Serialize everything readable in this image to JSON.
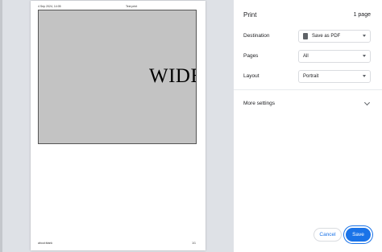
{
  "preview": {
    "header_left": "4 Sep 2024, 14:05",
    "header_center": "Test print",
    "footer_left": "about:blank",
    "footer_right": "1/1",
    "content_text": "WIDE"
  },
  "settings": {
    "title": "Print",
    "page_count": "1 page",
    "destination": {
      "label": "Destination",
      "value": "Save as PDF",
      "icon": "file-icon"
    },
    "pages": {
      "label": "Pages",
      "value": "All"
    },
    "layout": {
      "label": "Layout",
      "value": "Portrait"
    },
    "more_settings": "More settings"
  },
  "buttons": {
    "cancel": "Cancel",
    "save": "Save"
  },
  "colors": {
    "accent": "#1a73e8",
    "preview_background": "#dee1e6",
    "content_box": "#c3c3c3"
  }
}
